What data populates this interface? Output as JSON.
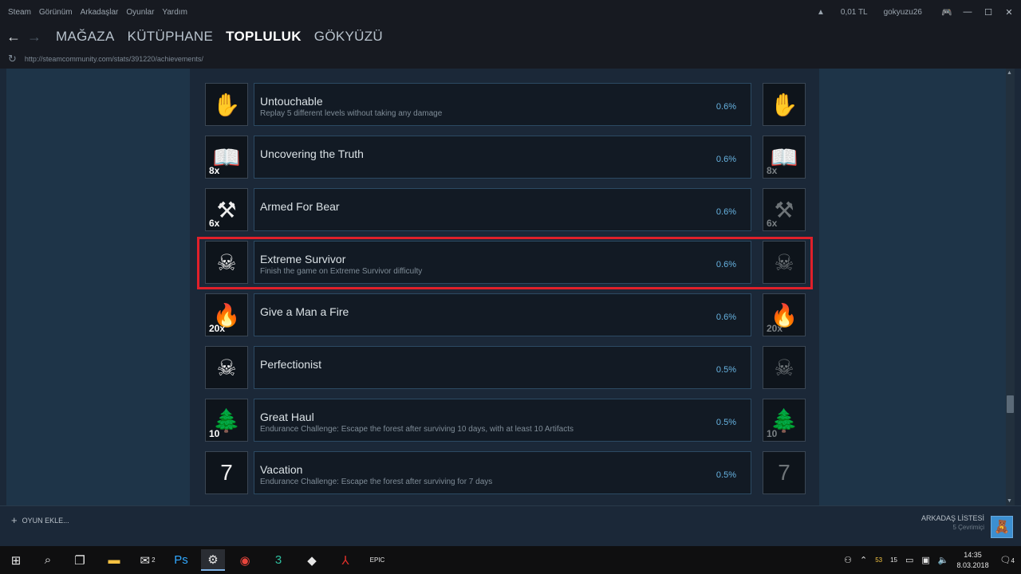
{
  "menu": {
    "items": [
      "Steam",
      "Görünüm",
      "Arkadaşlar",
      "Oyunlar",
      "Yardım"
    ],
    "balance": "0,01 TL",
    "username": "gokyuzu26"
  },
  "nav": {
    "links": [
      "MAĞAZA",
      "KÜTÜPHANE",
      "TOPLULUK",
      "GÖKYÜZÜ"
    ],
    "active": "TOPLULUK"
  },
  "url": "http://steamcommunity.com/stats/391220/achievements/",
  "achievements": [
    {
      "name": "Untouchable",
      "desc": "Replay 5 different levels without taking any damage",
      "pct": "0.6%",
      "icon": "hand-icon",
      "glyph": "✋",
      "count": ""
    },
    {
      "name": "Uncovering the Truth",
      "desc": "",
      "pct": "0.6%",
      "icon": "book-icon",
      "glyph": "📖",
      "count": "8x"
    },
    {
      "name": "Armed For Bear",
      "desc": "",
      "pct": "0.6%",
      "icon": "axe-icon",
      "glyph": "⚒",
      "count": "6x"
    },
    {
      "name": "Extreme Survivor",
      "desc": "Finish the game on Extreme Survivor difficulty",
      "pct": "0.6%",
      "icon": "skull-wreath-icon",
      "glyph": "☠",
      "count": ""
    },
    {
      "name": "Give a Man a Fire",
      "desc": "",
      "pct": "0.6%",
      "icon": "fire-man-icon",
      "glyph": "🔥",
      "count": "20x"
    },
    {
      "name": "Perfectionist",
      "desc": "",
      "pct": "0.5%",
      "icon": "skull-crossbones-icon",
      "glyph": "☠",
      "count": ""
    },
    {
      "name": "Great Haul",
      "desc": "Endurance Challenge: Escape the forest after surviving 10 days, with at least 10 Artifacts",
      "pct": "0.5%",
      "icon": "haul-icon",
      "glyph": "🌲",
      "count": "10"
    },
    {
      "name": "Vacation",
      "desc": "Endurance Challenge: Escape the forest after surviving for 7 days",
      "pct": "0.5%",
      "icon": "vacation-icon",
      "glyph": "7",
      "count": ""
    }
  ],
  "bottom": {
    "add_game": "OYUN EKLE...",
    "friends_title": "ARKADAŞ LİSTESİ",
    "friends_online": "5 Çevrimiçi"
  },
  "taskbar": {
    "time": "14:35",
    "date": "8.03.2018",
    "mail_badge": "2",
    "notif_count": "4",
    "tray_num1": "53",
    "tray_num2": "15"
  }
}
